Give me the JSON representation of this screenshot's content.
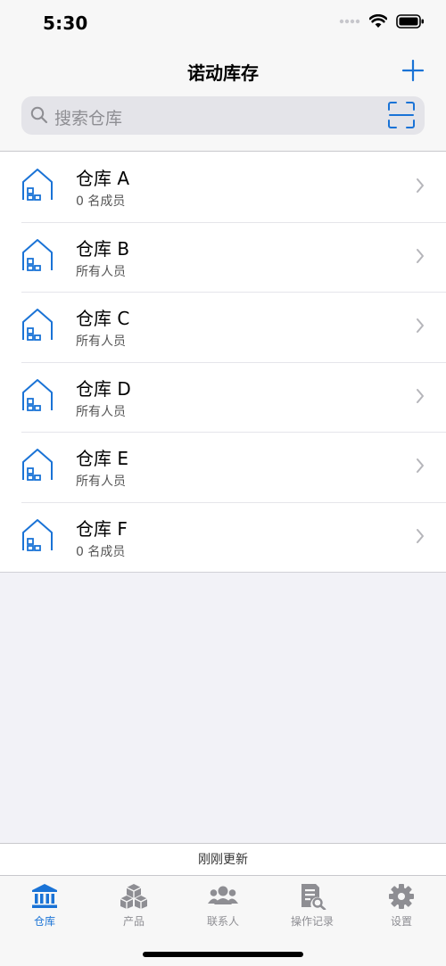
{
  "status_bar": {
    "time": "5:30"
  },
  "header": {
    "title": "诺动库存"
  },
  "search": {
    "placeholder": "搜索仓库"
  },
  "warehouses": [
    {
      "name": "仓库 A",
      "members": "0 名成员"
    },
    {
      "name": "仓库 B",
      "members": "所有人员"
    },
    {
      "name": "仓库 C",
      "members": "所有人员"
    },
    {
      "name": "仓库 D",
      "members": "所有人员"
    },
    {
      "name": "仓库 E",
      "members": "所有人员"
    },
    {
      "name": "仓库 F",
      "members": "0 名成员"
    }
  ],
  "refresh_status": "刚刚更新",
  "tabs": [
    {
      "label": "仓库",
      "icon": "warehouse-icon",
      "active": true
    },
    {
      "label": "产品",
      "icon": "boxes-icon",
      "active": false
    },
    {
      "label": "联系人",
      "icon": "people-icon",
      "active": false
    },
    {
      "label": "操作记录",
      "icon": "records-icon",
      "active": false
    },
    {
      "label": "设置",
      "icon": "gear-icon",
      "active": false
    }
  ],
  "colors": {
    "accent": "#1a73d6",
    "inactive": "#8e8e93",
    "background": "#f2f2f7"
  }
}
